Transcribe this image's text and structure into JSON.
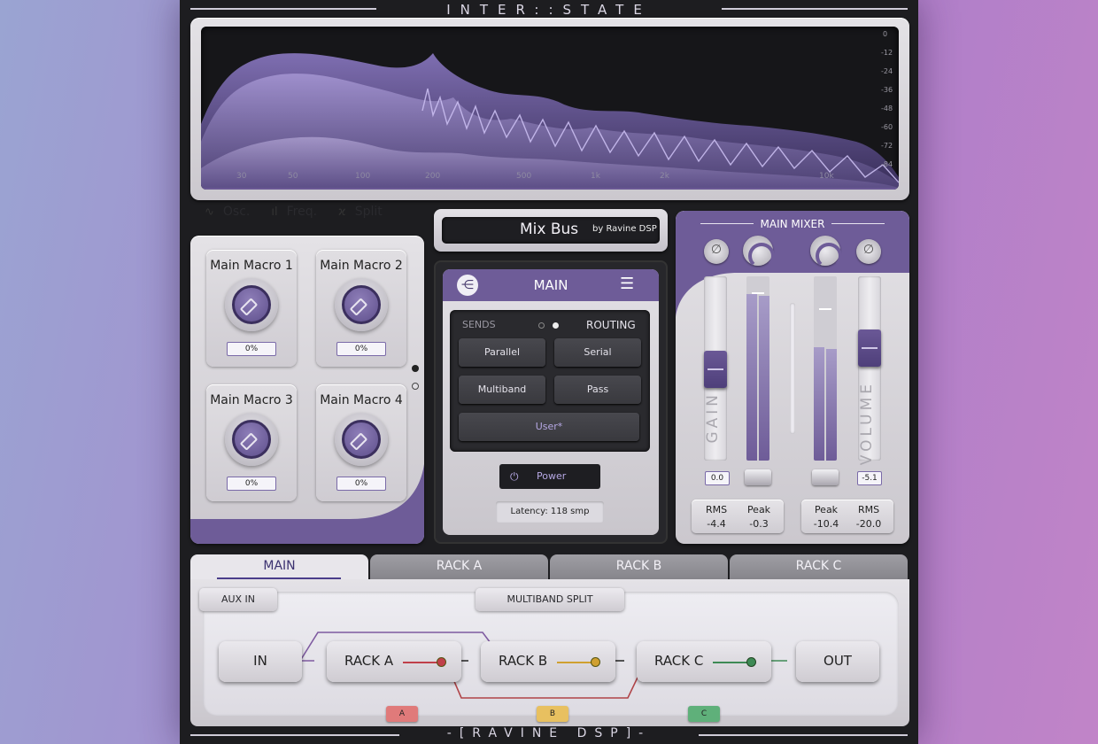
{
  "header": {
    "title": "INTER::STATE"
  },
  "footer": {
    "title": "-[RAVINE DSP]-"
  },
  "spectrum": {
    "db_ticks": [
      "0",
      "-12",
      "-24",
      "-36",
      "-48",
      "-60",
      "-72",
      "-84"
    ],
    "freq_ticks": [
      "30",
      "50",
      "100",
      "200",
      "500",
      "1k",
      "2k",
      "10k"
    ],
    "modes": [
      {
        "icon": "∿",
        "label": "Osc."
      },
      {
        "icon": "ıl",
        "label": "Freq."
      },
      {
        "icon": "ϰ",
        "label": "Split"
      }
    ]
  },
  "macros": [
    {
      "name": "Main Macro 1",
      "value": "0%"
    },
    {
      "name": "Main Macro 2",
      "value": "0%"
    },
    {
      "name": "Main Macro 3",
      "value": "0%"
    },
    {
      "name": "Main Macro 4",
      "value": "0%"
    }
  ],
  "preset": {
    "name": "Mix Bus",
    "by": "by Ravine DSP"
  },
  "main": {
    "title": "MAIN",
    "logo": "⋲",
    "menu": "☰",
    "sends_label": "SENDS",
    "routing_label": "ROUTING",
    "buttons": [
      "Parallel",
      "Serial",
      "Multiband",
      "Pass"
    ],
    "user": "User*",
    "power": "Power",
    "power_icon": "⏻",
    "latency": "Latency: 118 smp"
  },
  "mixer": {
    "title": "MAIN MIXER",
    "gain_label": "GAIN",
    "volume_label": "VOLUME",
    "gain_value": "0.0",
    "volume_value": "-5.1",
    "phase_icon": "∅",
    "left_stats": [
      {
        "label": "RMS",
        "value": "-4.4"
      },
      {
        "label": "Peak",
        "value": "-0.3"
      }
    ],
    "right_stats": [
      {
        "label": "Peak",
        "value": "-10.4"
      },
      {
        "label": "RMS",
        "value": "-20.0"
      }
    ]
  },
  "tabs": [
    "MAIN",
    "RACK A",
    "RACK B",
    "RACK C"
  ],
  "routing": {
    "aux_in": "AUX IN",
    "multiband_split": "MULTIBAND SPLIT",
    "in": "IN",
    "out": "OUT",
    "racks": [
      {
        "label": "RACK A",
        "color": "#c0404a"
      },
      {
        "label": "RACK B",
        "color": "#d0a030"
      },
      {
        "label": "RACK C",
        "color": "#3e8a55"
      }
    ],
    "tags": [
      {
        "label": "A",
        "color": "#e07a7a"
      },
      {
        "label": "B",
        "color": "#e8c060"
      },
      {
        "label": "C",
        "color": "#5fb07a"
      }
    ]
  },
  "colors": {
    "accent": "#6e5c98",
    "dark": "#1d1d20"
  }
}
